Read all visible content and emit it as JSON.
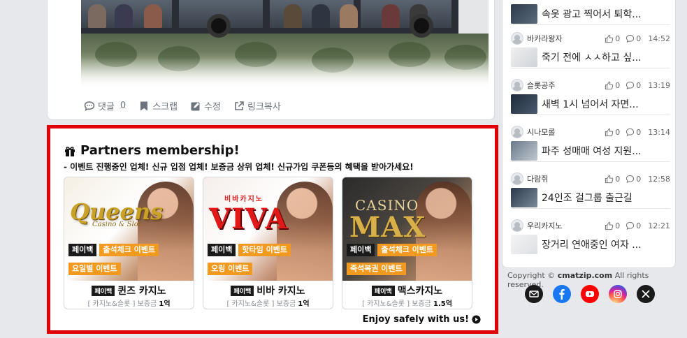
{
  "post": {
    "actions": {
      "comments_label": "댓글",
      "comments_count": "0",
      "scrap_label": "스크랩",
      "edit_label": "수정",
      "copy_link_label": "링크복사"
    }
  },
  "partners": {
    "title": "Partners membership!",
    "subtitle": "- 이벤트 진행중인 업체! 신규 입점 업체! 보증금 상위 업체! 신규가입 쿠폰등의 혜택을 받아가세요!",
    "cards": [
      {
        "logo": "Queens",
        "logo_sub": "Casino & Slot",
        "tags_row1": [
          "페이백",
          "출석체크 이벤트"
        ],
        "tags_row2": [
          "요일별 이벤트"
        ],
        "name_badge": "페이백",
        "name": "퀸즈 카지노",
        "category": "[ 카지노&슬롯 ]",
        "deposit_label": "보증금",
        "deposit_value": "1억"
      },
      {
        "logo": "VIVA",
        "logo_sub": "비바카지노",
        "tags_row1": [
          "페이백",
          "핫타임 이벤트"
        ],
        "tags_row2": [
          "오링 이벤트"
        ],
        "name_badge": "페이백",
        "name": "비바 카지노",
        "category": "[ 카지노&슬롯 ]",
        "deposit_label": "보증금",
        "deposit_value": "1억"
      },
      {
        "logo": "MAX",
        "logo_sub": "CASINO",
        "tags_row1": [
          "페이백",
          "출석체크 이벤트"
        ],
        "tags_row2": [
          "죽석복권 이벤트"
        ],
        "name_badge": "페이백",
        "name": "맥스카지노",
        "category": "[ 카지노&슬롯 ]",
        "deposit_label": "보증금",
        "deposit_value": "1.5억"
      }
    ],
    "enjoy_label": "Enjoy safely with us!"
  },
  "sidebar": {
    "top_title": "속옷 광고 찍어서 퇴학...",
    "items": [
      {
        "author": "바카라왕자",
        "likes": "0",
        "comments": "0",
        "time": "14:52",
        "title": "죽기 전에 ㅅㅅ하고 싶..."
      },
      {
        "author": "슬롯공주",
        "likes": "0",
        "comments": "0",
        "time": "13:19",
        "title": "새벽 1시 넘어서 자면..."
      },
      {
        "author": "시나모롤",
        "likes": "0",
        "comments": "0",
        "time": "13:14",
        "title": "파주 성매매 여성 지원..."
      },
      {
        "author": "다람쥐",
        "likes": "0",
        "comments": "0",
        "time": "12:58",
        "title": "24인조 걸그룹 출근길"
      },
      {
        "author": "우리카지노",
        "likes": "0",
        "comments": "0",
        "time": "12:21",
        "title": "장거리 연애중인 여자 ..."
      }
    ]
  },
  "footer": {
    "copyright_prefix": "Copyright ©",
    "site": "cmatzip.com",
    "copyright_suffix": "All rights reserved."
  },
  "colors": {
    "partners_border": "#e00000",
    "tag_orange": "#f29a1f",
    "tag_black": "#1a1a1a",
    "email": "#1a1a1a",
    "facebook": "#1877f2",
    "youtube": "#ff0000",
    "instagram": "#d6249f",
    "x": "#1a1a1a"
  }
}
